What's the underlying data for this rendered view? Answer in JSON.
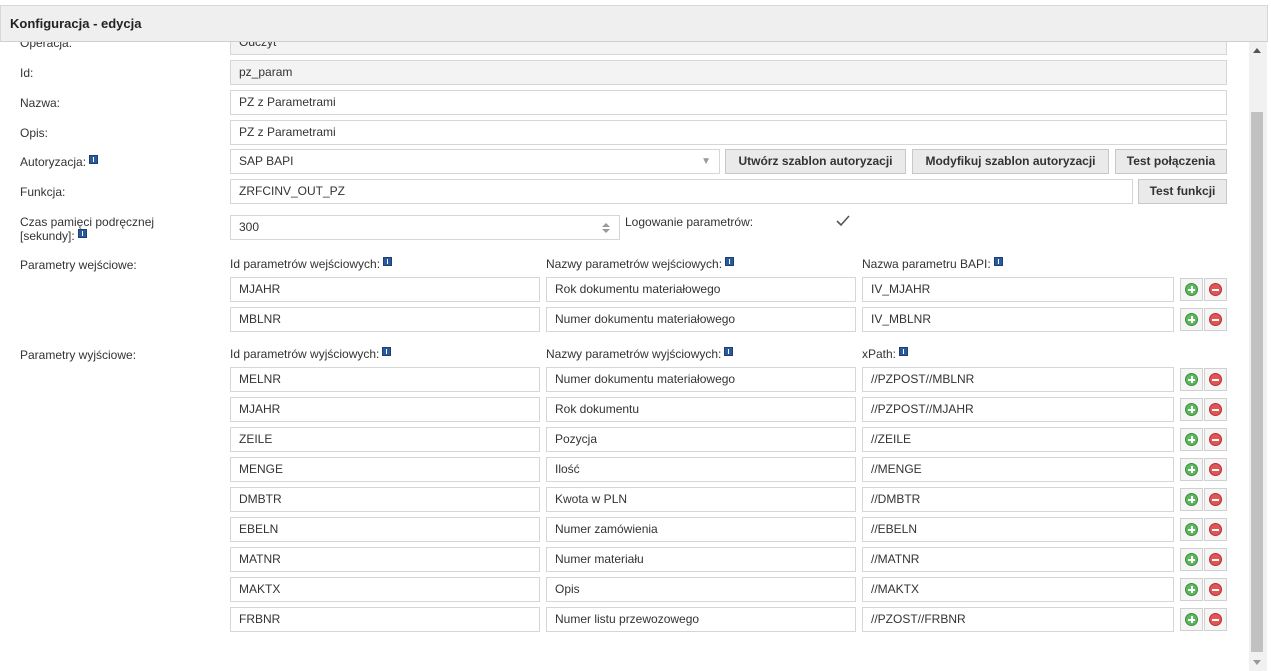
{
  "window": {
    "title": "Konfiguracja - edycja"
  },
  "form": {
    "operacja": {
      "label": "Operacja:",
      "value": "Odczyt"
    },
    "id": {
      "label": "Id:",
      "value": "pz_param"
    },
    "nazwa": {
      "label": "Nazwa:",
      "value": "PZ z Parametrami"
    },
    "opis": {
      "label": "Opis:",
      "value": "PZ z Parametrami"
    },
    "autoryzacja": {
      "label": "Autoryzacja:",
      "value": "SAP BAPI",
      "buttons": {
        "create": "Utwórz szablon autoryzacji",
        "modify": "Modyfikuj szablon autoryzacji",
        "test": "Test połączenia"
      }
    },
    "funkcja": {
      "label": "Funkcja:",
      "value": "ZRFCINV_OUT_PZ",
      "test_button": "Test funkcji"
    },
    "cache": {
      "label_line1": "Czas pamięci podręcznej",
      "label_line2": "[sekundy]:",
      "value": "300"
    },
    "logging": {
      "label": "Logowanie parametrów:",
      "checked": true
    }
  },
  "input_params": {
    "label": "Parametry wejściowe:",
    "headers": [
      "Id parametrów wejściowych:",
      "Nazwy parametrów wejściowych:",
      "Nazwa parametru BAPI:"
    ],
    "rows": [
      [
        "MJAHR",
        "Rok dokumentu materiałowego",
        "IV_MJAHR"
      ],
      [
        "MBLNR",
        "Numer dokumentu materiałowego",
        "IV_MBLNR"
      ]
    ]
  },
  "output_params": {
    "label": "Parametry wyjściowe:",
    "headers": [
      "Id parametrów wyjściowych:",
      "Nazwy parametrów wyjściowych:",
      "xPath:"
    ],
    "rows": [
      [
        "MELNR",
        "Numer dokumentu materiałowego",
        "//PZPOST//MBLNR"
      ],
      [
        "MJAHR",
        "Rok dokumentu",
        "//PZPOST//MJAHR"
      ],
      [
        "ZEILE",
        "Pozycja",
        "//ZEILE"
      ],
      [
        "MENGE",
        "Ilość",
        "//MENGE"
      ],
      [
        "DMBTR",
        "Kwota w PLN",
        "//DMBTR"
      ],
      [
        "EBELN",
        "Numer zamówienia",
        "//EBELN"
      ],
      [
        "MATNR",
        "Numer materiału",
        "//MATNR"
      ],
      [
        "MAKTX",
        "Opis",
        "//MAKTX"
      ],
      [
        "FRBNR",
        "Numer listu przewozowego",
        "//PZOST//FRBNR"
      ]
    ]
  },
  "colors": {
    "add": "#5cb85c",
    "remove": "#e05555",
    "info": "#2a5a9e"
  }
}
